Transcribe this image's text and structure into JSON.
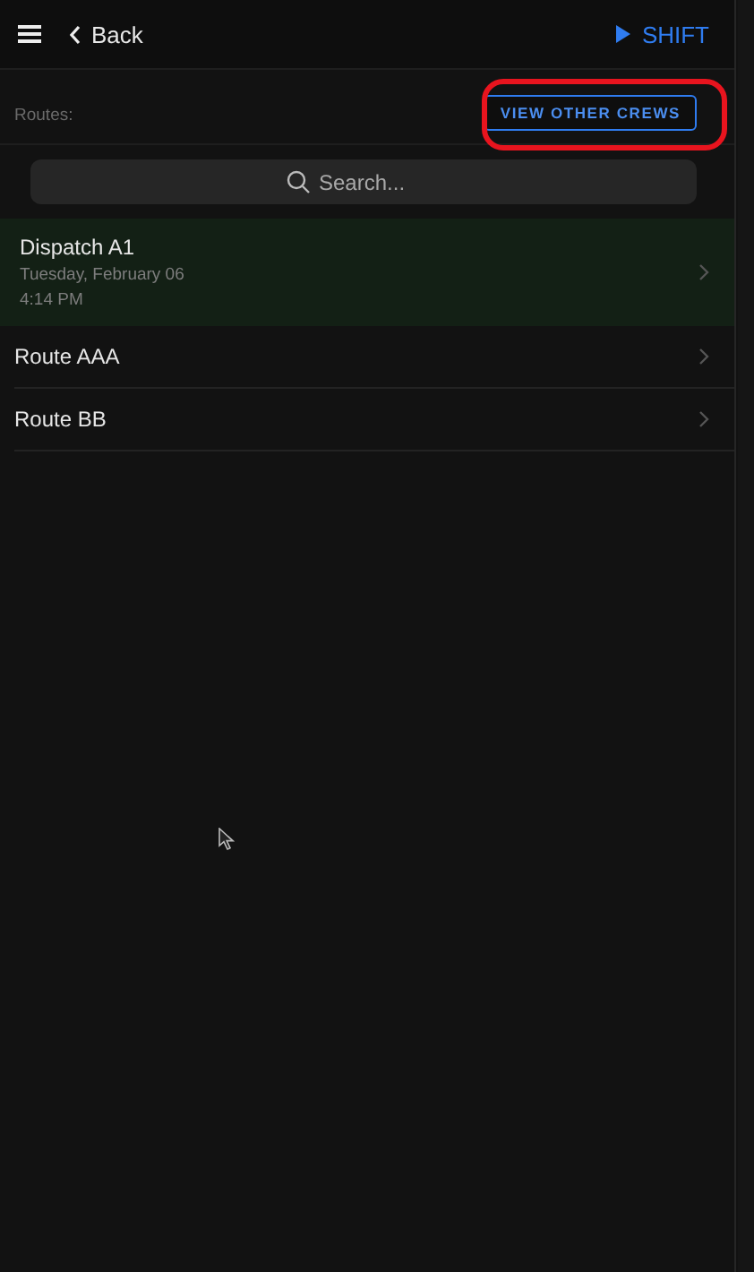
{
  "header": {
    "back_label": "Back",
    "shift_label": "SHIFT"
  },
  "routes_label": "Routes:",
  "view_other_crews": {
    "label": "VIEW OTHER CREWS",
    "highlighted": true
  },
  "search": {
    "placeholder": "Search..."
  },
  "routes": [
    {
      "name": "Dispatch A1",
      "date": "Tuesday, February 06",
      "time": "4:14 PM",
      "selected": true
    },
    {
      "name": "Route AAA",
      "selected": false
    },
    {
      "name": "Route BB",
      "selected": false
    }
  ]
}
